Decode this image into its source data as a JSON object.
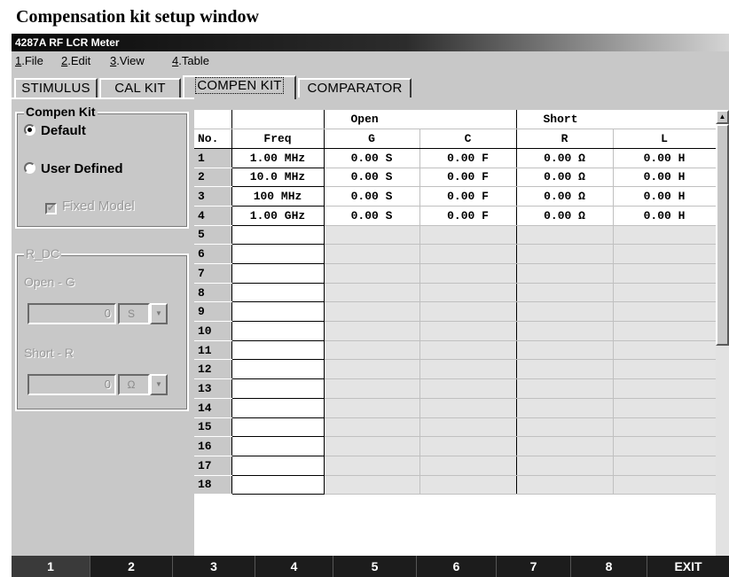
{
  "caption": "Compensation kit setup window",
  "window": {
    "title": "4287A RF LCR Meter"
  },
  "menu": [
    {
      "key": "1",
      "label": ".File"
    },
    {
      "key": "2",
      "label": ".Edit"
    },
    {
      "key": "3",
      "label": ".View"
    },
    {
      "key": "4",
      "label": ".Table"
    }
  ],
  "tabs": [
    "STIMULUS",
    "CAL KIT",
    "COMPEN KIT",
    "COMPARATOR"
  ],
  "active_tab": "COMPEN KIT",
  "compen_kit": {
    "legend": "Compen Kit",
    "option_default": "Default",
    "option_user": "User Defined",
    "selected": "Default",
    "fixed_model_label": "Fixed Model",
    "fixed_model_checked": true
  },
  "r_dc": {
    "legend": "R_DC",
    "open_label": "Open - G",
    "open_value": "0",
    "open_unit": "S",
    "short_label": "Short - R",
    "short_value": "0",
    "short_unit": "Ω"
  },
  "table": {
    "group_open": "Open",
    "group_short": "Short",
    "col_no": "No.",
    "col_freq": "Freq",
    "col_g": "G",
    "col_c": "C",
    "col_r": "R",
    "col_l": "L",
    "rows": [
      {
        "no": "1",
        "freq": "1.00 MHz",
        "g": "0.00 S",
        "c": "0.00 F",
        "r": "0.00 Ω",
        "l": "0.00 H"
      },
      {
        "no": "2",
        "freq": "10.0 MHz",
        "g": "0.00 S",
        "c": "0.00 F",
        "r": "0.00 Ω",
        "l": "0.00 H"
      },
      {
        "no": "3",
        "freq": "100 MHz",
        "g": "0.00 S",
        "c": "0.00 F",
        "r": "0.00 Ω",
        "l": "0.00 H"
      },
      {
        "no": "4",
        "freq": "1.00 GHz",
        "g": "0.00 S",
        "c": "0.00 F",
        "r": "0.00 Ω",
        "l": "0.00 H"
      },
      {
        "no": "5",
        "freq": "",
        "g": "",
        "c": "",
        "r": "",
        "l": ""
      },
      {
        "no": "6",
        "freq": "",
        "g": "",
        "c": "",
        "r": "",
        "l": ""
      },
      {
        "no": "7",
        "freq": "",
        "g": "",
        "c": "",
        "r": "",
        "l": ""
      },
      {
        "no": "8",
        "freq": "",
        "g": "",
        "c": "",
        "r": "",
        "l": ""
      },
      {
        "no": "9",
        "freq": "",
        "g": "",
        "c": "",
        "r": "",
        "l": ""
      },
      {
        "no": "10",
        "freq": "",
        "g": "",
        "c": "",
        "r": "",
        "l": ""
      },
      {
        "no": "11",
        "freq": "",
        "g": "",
        "c": "",
        "r": "",
        "l": ""
      },
      {
        "no": "12",
        "freq": "",
        "g": "",
        "c": "",
        "r": "",
        "l": ""
      },
      {
        "no": "13",
        "freq": "",
        "g": "",
        "c": "",
        "r": "",
        "l": ""
      },
      {
        "no": "14",
        "freq": "",
        "g": "",
        "c": "",
        "r": "",
        "l": ""
      },
      {
        "no": "15",
        "freq": "",
        "g": "",
        "c": "",
        "r": "",
        "l": ""
      },
      {
        "no": "16",
        "freq": "",
        "g": "",
        "c": "",
        "r": "",
        "l": ""
      },
      {
        "no": "17",
        "freq": "",
        "g": "",
        "c": "",
        "r": "",
        "l": ""
      },
      {
        "no": "18",
        "freq": "",
        "g": "",
        "c": "",
        "r": "",
        "l": ""
      }
    ]
  },
  "softkeys": [
    "1",
    "2",
    "3",
    "4",
    "5",
    "6",
    "7",
    "8",
    "EXIT"
  ],
  "icons": {
    "scroll_up": "triangle-up-icon",
    "scroll_down": "triangle-down-icon",
    "dropdown": "chevron-down-icon"
  }
}
